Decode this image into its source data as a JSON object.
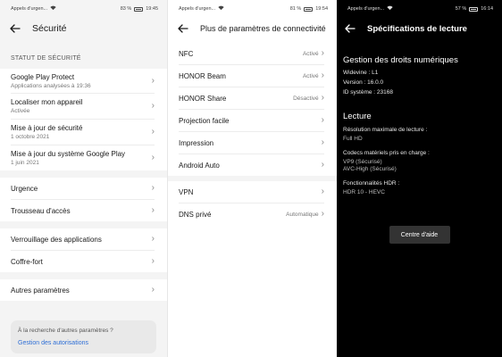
{
  "status_left_text": "Appels d'urgen...",
  "panel1": {
    "status": {
      "battery": "83 %",
      "time": "19:45"
    },
    "title": "Sécurité",
    "section_label": "STATUT DE SÉCURITÉ",
    "status_items": [
      {
        "title": "Google Play Protect",
        "sub": "Applications analysées à 19:36"
      },
      {
        "title": "Localiser mon appareil",
        "sub": "Activée"
      },
      {
        "title": "Mise à jour de sécurité",
        "sub": "1 octobre 2021"
      },
      {
        "title": "Mise à jour du système Google Play",
        "sub": "1 juin 2021"
      }
    ],
    "group2": [
      {
        "title": "Urgence"
      },
      {
        "title": "Trousseau d'accès"
      }
    ],
    "group3": [
      {
        "title": "Verrouillage des applications"
      },
      {
        "title": "Coffre-fort"
      }
    ],
    "group4": [
      {
        "title": "Autres paramètres"
      }
    ],
    "info_question": "À la recherche d'autres paramètres ?",
    "info_link": "Gestion des autorisations"
  },
  "panel2": {
    "status": {
      "battery": "81 %",
      "time": "19:54"
    },
    "title": "Plus de paramètres de connectivité",
    "items": [
      {
        "title": "NFC",
        "value": "Activé"
      },
      {
        "title": "HONOR Beam",
        "value": "Activé"
      },
      {
        "title": "HONOR Share",
        "value": "Désactivé"
      },
      {
        "title": "Projection facile",
        "value": ""
      },
      {
        "title": "Impression",
        "value": ""
      },
      {
        "title": "Android Auto",
        "value": ""
      }
    ],
    "items2": [
      {
        "title": "VPN",
        "value": ""
      },
      {
        "title": "DNS privé",
        "value": "Automatique"
      }
    ]
  },
  "panel3": {
    "status": {
      "battery": "57 %",
      "time": "16:14"
    },
    "title": "Spécifications de lecture",
    "drm_heading": "Gestion des droits numériques",
    "widevine": "Widevine : L1",
    "version": "Version : 16.0.0",
    "system_id": "ID système : 23168",
    "playback_heading": "Lecture",
    "max_res_label": "Résolution maximale de lecture :",
    "max_res_value": "Full HD",
    "codecs_label": "Codecs matériels pris en charge :",
    "codec_1": "VP9 (Sécurisé)",
    "codec_2": "AVC-High (Sécurisé)",
    "hdr_label": "Fonctionnalités HDR :",
    "hdr_value": "HDR 10 - HEVC",
    "help_button": "Centre d'aide"
  },
  "icons": {
    "back": "back-arrow-icon",
    "chevron": "chevron-right-icon",
    "battery": "battery-icon",
    "wifi": "wifi-icon"
  }
}
